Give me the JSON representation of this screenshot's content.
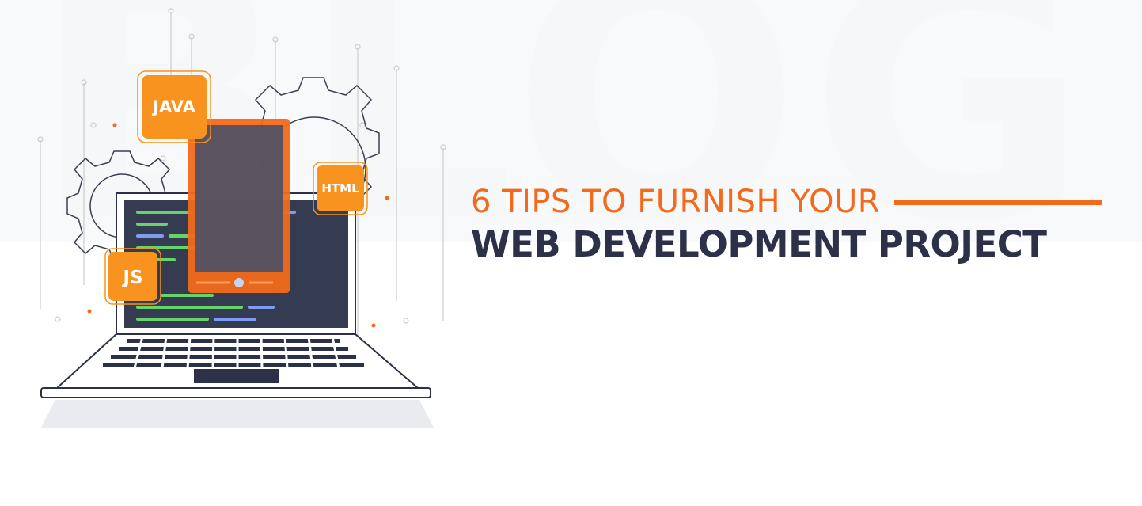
{
  "background_watermark": "BLOG",
  "headline": {
    "subtitle": "6 TIPS TO FURNISH YOUR",
    "title": "WEB DEVELOPMENT PROJECT"
  },
  "badges": {
    "java": "JAVA",
    "html": "HTML",
    "js": "JS"
  },
  "colors": {
    "accent": "#f26a1b",
    "badge": "#f7931e",
    "dark": "#2c3148",
    "screen": "#353c52",
    "code_green": "#67d36b",
    "code_blue": "#7d9cf4"
  },
  "icons": [
    "gear-icon",
    "laptop-icon",
    "phone-icon",
    "code-lines-icon"
  ]
}
